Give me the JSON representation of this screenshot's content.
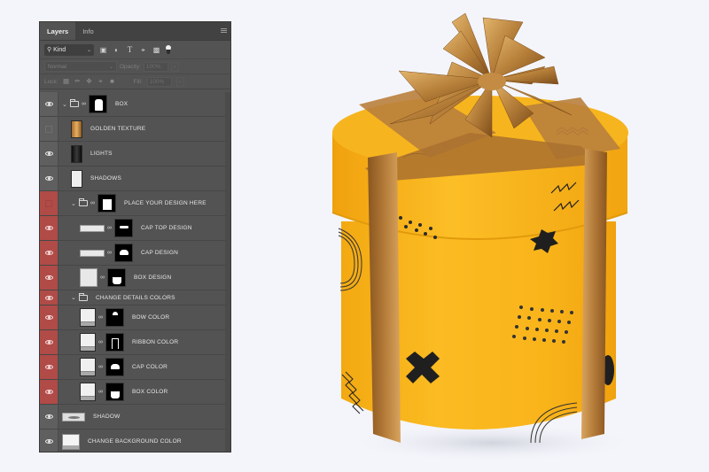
{
  "panel": {
    "tabs": [
      {
        "label": "Layers",
        "active": true
      },
      {
        "label": "Info",
        "active": false
      }
    ],
    "menu_icon": "panel-menu-icon",
    "filter": {
      "kind_label": "Kind",
      "kind_icon": "search-icon",
      "filter_icons": [
        "pixel-layer-filter-icon",
        "adjustment-layer-filter-icon",
        "type-layer-filter-icon",
        "shape-layer-filter-icon",
        "smart-object-filter-icon",
        "filter-toggle-icon"
      ]
    },
    "blend": {
      "mode": "Normal",
      "opacity_label": "Opacity:",
      "opacity_value": "100%"
    },
    "lock": {
      "label": "Lock:",
      "lock_icons": [
        "lock-transparent-pixels-icon",
        "lock-image-pixels-icon",
        "lock-position-icon",
        "lock-artboard-icon",
        "lock-all-icon"
      ],
      "fill_label": "Fill:",
      "fill_value": "100%"
    }
  },
  "layers": [
    {
      "name": "BOX",
      "type": "group",
      "visible": true,
      "highlight": false,
      "level": 0,
      "expanded": true
    },
    {
      "name": "GOLDEN TEXTURE",
      "type": "pixel",
      "visible": false,
      "highlight": false,
      "level": 1
    },
    {
      "name": "LIGHTS",
      "type": "pixel",
      "visible": true,
      "highlight": false,
      "level": 1
    },
    {
      "name": "SHADOWS",
      "type": "pixel",
      "visible": true,
      "highlight": false,
      "level": 1
    },
    {
      "name": "PLACE YOUR DESIGN HERE",
      "type": "group",
      "visible": false,
      "highlight": true,
      "level": 1,
      "expanded": true
    },
    {
      "name": "CAP TOP DESIGN",
      "type": "smart-object",
      "visible": true,
      "highlight": true,
      "level": 2
    },
    {
      "name": "CAP DESIGN",
      "type": "smart-object",
      "visible": true,
      "highlight": true,
      "level": 2
    },
    {
      "name": "BOX DESIGN",
      "type": "smart-object",
      "visible": true,
      "highlight": true,
      "level": 2
    },
    {
      "name": "CHANGE DETAILS COLORS",
      "type": "group",
      "visible": true,
      "highlight": true,
      "level": 1,
      "expanded": true
    },
    {
      "name": "BOW COLOR",
      "type": "fill",
      "visible": true,
      "highlight": true,
      "level": 2
    },
    {
      "name": "RIBBON COLOR",
      "type": "fill",
      "visible": true,
      "highlight": true,
      "level": 2
    },
    {
      "name": "CAP COLOR",
      "type": "fill",
      "visible": true,
      "highlight": true,
      "level": 2
    },
    {
      "name": "BOX COLOR",
      "type": "fill",
      "visible": true,
      "highlight": true,
      "level": 2
    },
    {
      "name": "SHADOW",
      "type": "pixel",
      "visible": true,
      "highlight": false,
      "level": 0
    },
    {
      "name": "CHANGE BACKGROUND COLOR",
      "type": "fill",
      "visible": true,
      "highlight": false,
      "level": 0
    }
  ],
  "colors": {
    "panel_bg": "#535353",
    "highlight_red": "#b04b47",
    "page_bg": "#f4f5fb",
    "box_yellow": "#f6b51e",
    "ribbon_gold": "#b9803c",
    "pattern_black": "#1f1f1f"
  },
  "illustration": {
    "subject": "yellow cylindrical gift box with golden ribbon and bow, black memphis pattern"
  }
}
